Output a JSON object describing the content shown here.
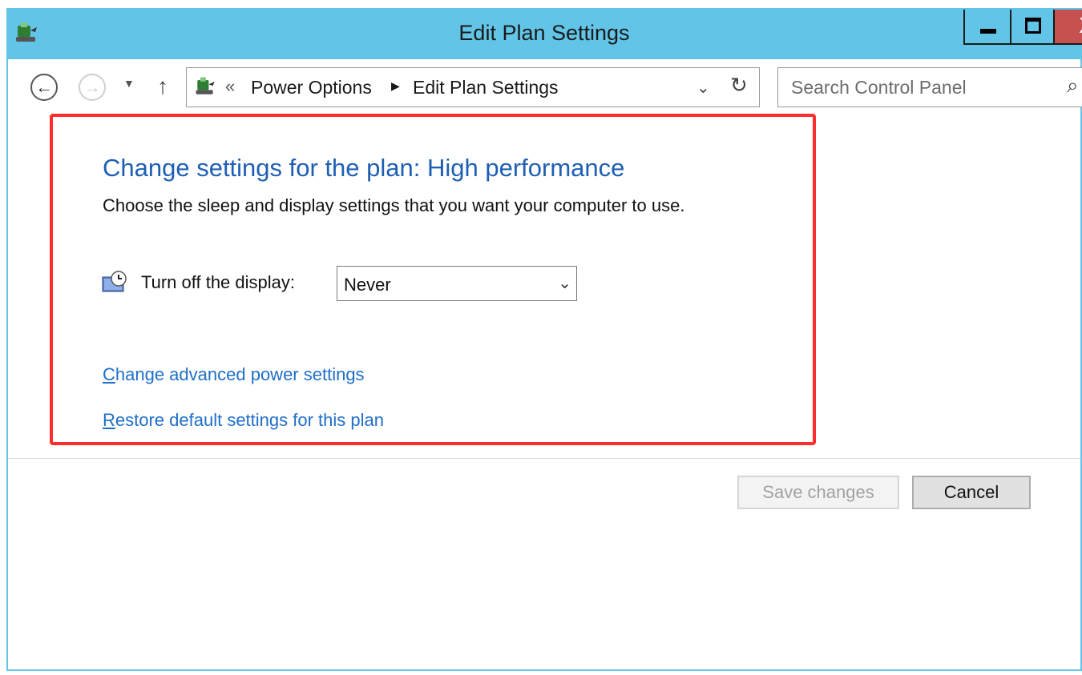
{
  "window": {
    "title": "Edit Plan Settings",
    "close_glyph": "X"
  },
  "nav": {
    "back_glyph": "←",
    "forward_glyph": "→",
    "recent_glyph": "▼",
    "up_glyph": "↑"
  },
  "address": {
    "chevron": "«",
    "crumbs": [
      "Power Options",
      "Edit Plan Settings"
    ],
    "separator": "▶",
    "dropdown_glyph": "⌄",
    "refresh_glyph": "↻"
  },
  "search": {
    "placeholder": "Search Control Panel",
    "icon_glyph": "⌕"
  },
  "content": {
    "heading": "Change settings for the plan: High performance",
    "description": "Choose the sleep and display settings that you want your computer to use.",
    "display_label": "Turn off the display:",
    "display_value": "Never",
    "select_arrow": "⌄",
    "advanced_link": {
      "first": "C",
      "rest": "hange advanced power settings"
    },
    "restore_link": {
      "first": "R",
      "rest": "estore default settings for this plan"
    }
  },
  "buttons": {
    "save": "Save changes",
    "cancel": "Cancel"
  },
  "colors": {
    "titlebar": "#62c5e8",
    "link": "#1e6fc8",
    "heading": "#1e5fb4",
    "highlight": "#ff2e2e",
    "close_button": "#c75050"
  },
  "icons": {
    "title": "power-options-icon",
    "address": "power-options-icon",
    "display": "monitor-clock-icon"
  }
}
